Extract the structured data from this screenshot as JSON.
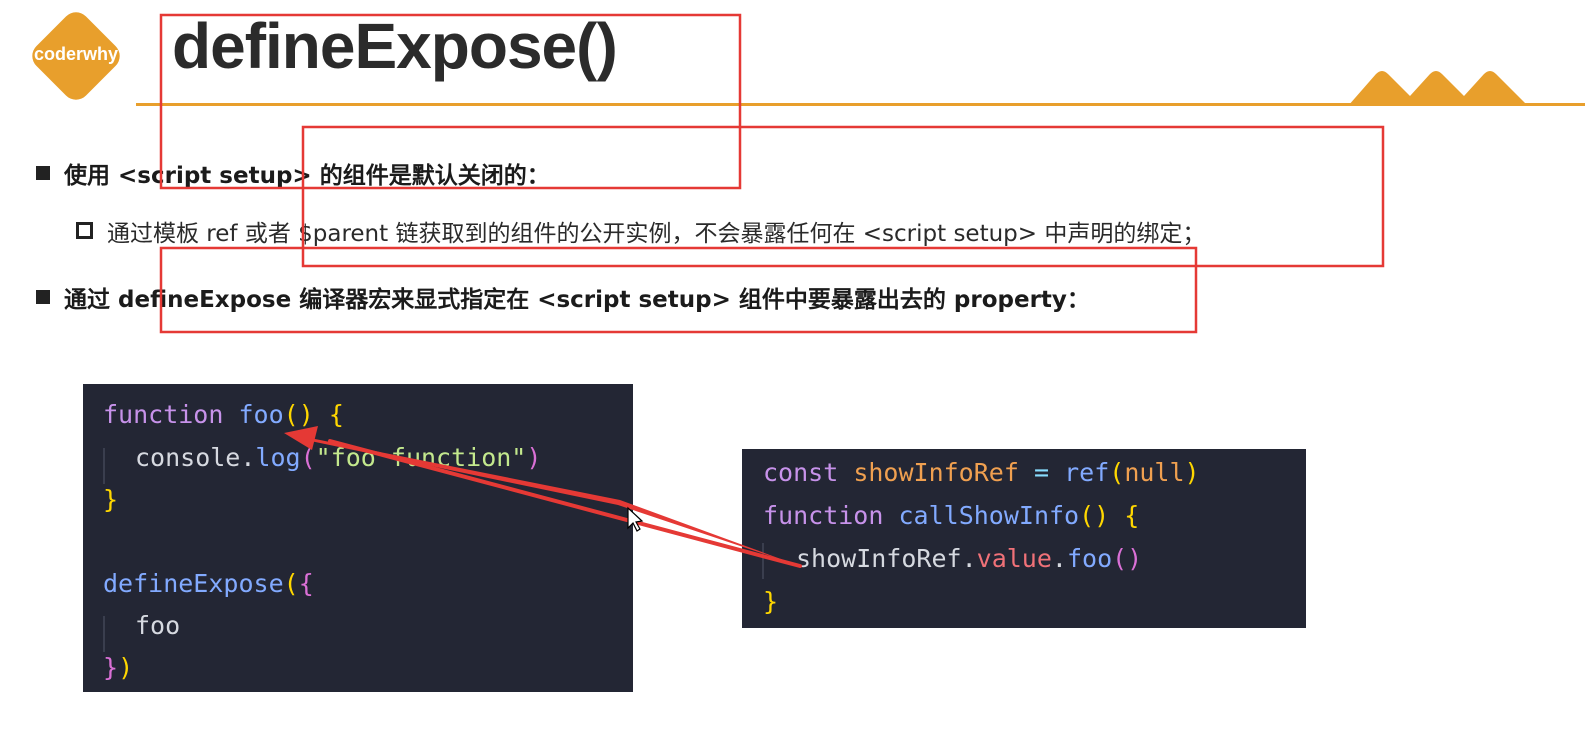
{
  "logo": {
    "text": "coderwhy",
    "color": "#e89f2c"
  },
  "title": "defineExpose()",
  "bullets": [
    {
      "text": "使用 <script setup> 的组件是默认关闭的："
    },
    {
      "text": "通过 defineExpose 编译器宏来显式指定在 <script setup> 组件中要暴露出去的 property："
    }
  ],
  "sub_bullet": {
    "text": "通过模板 ref 或者 $parent 链获取到的组件的公开实例，不会暴露任何在 <script setup> 中声明的绑定；"
  },
  "code_left": {
    "line1": {
      "kw": "function",
      "fn": "foo",
      "paren": "()",
      "brace": "{"
    },
    "line2": {
      "obj": "console",
      "dot": ".",
      "method": "log",
      "open": "(",
      "str": "\"foo function\"",
      "close": ")"
    },
    "line3": {
      "brace": "}"
    },
    "line5": {
      "fn": "defineExpose",
      "open": "(",
      "brace": "{"
    },
    "line6": {
      "prop": "foo"
    },
    "line7": {
      "brace": "}",
      "close": ")"
    }
  },
  "code_right": {
    "line1": {
      "kw": "const",
      "var": "showInfoRef",
      "op": "=",
      "fn": "ref",
      "open": "(",
      "arg": "null",
      "close": ")"
    },
    "line2": {
      "kw": "function",
      "fn": "callShowInfo",
      "paren": "()",
      "brace": "{"
    },
    "line3": {
      "obj": "showInfoRef",
      "dot1": ".",
      "prop": "value",
      "dot2": ".",
      "method": "foo",
      "paren": "()"
    },
    "line4": {
      "brace": "}"
    }
  },
  "colors": {
    "accent": "#e89f2c",
    "annotation_red": "#e53935",
    "code_bg": "#232634"
  }
}
